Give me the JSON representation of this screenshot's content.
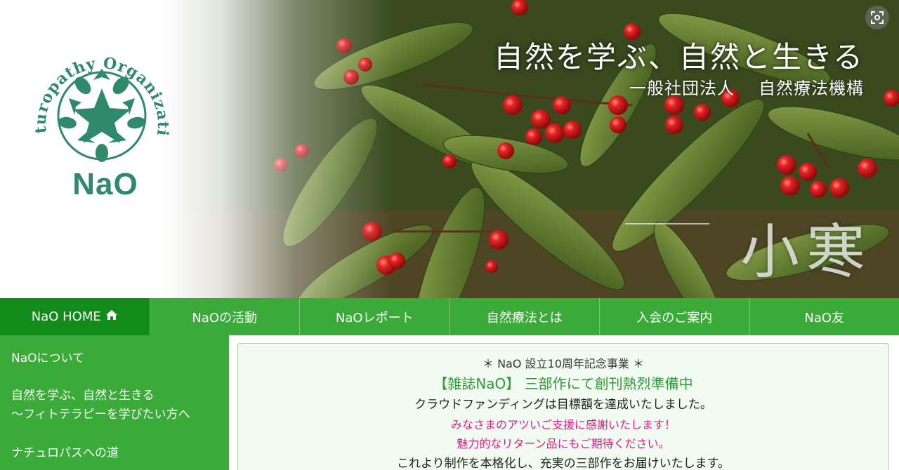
{
  "logo": {
    "arc_text": "Naturopathy Organization",
    "title": "NaO"
  },
  "hero": {
    "tagline": "自然を学ぶ、自然と生きる",
    "org_type": "一般社団法人",
    "org_name": "自然療法機構",
    "season": "小寒"
  },
  "nav": {
    "items": [
      {
        "label": "NaO HOME"
      },
      {
        "label": "NaOの活動"
      },
      {
        "label": "NaOレポート"
      },
      {
        "label": "自然療法とは"
      },
      {
        "label": "入会のご案内"
      },
      {
        "label": "NaO友"
      }
    ]
  },
  "sidebar": {
    "items": [
      {
        "label": "NaOについて"
      },
      {
        "line1": "自然を学ぶ、自然と生きる",
        "line2": "～フィトテラピーを学びたい方へ"
      },
      {
        "label": "ナチュロパスへの道"
      }
    ]
  },
  "main": {
    "heading": "＊ NaO 設立10周年記念事業 ＊",
    "headline": "【雑誌NaO】 三部作にて創刊熱烈準備中",
    "line1": "クラウドファンディングは目標額を達成いたしました。",
    "thanks1": "みなさまのアツいご支援に感謝いたします！",
    "thanks2": "魅力的なリターン品にもご期待ください。",
    "line2": "これより制作を本格化し、充実の三部作をお届けいたします。"
  },
  "colors": {
    "nav_green": "#3aaa38",
    "nav_active": "#118c1a",
    "logo_green": "#2e8a6a",
    "headline_green": "#2e9a35",
    "accent_pink": "#e31c83"
  }
}
